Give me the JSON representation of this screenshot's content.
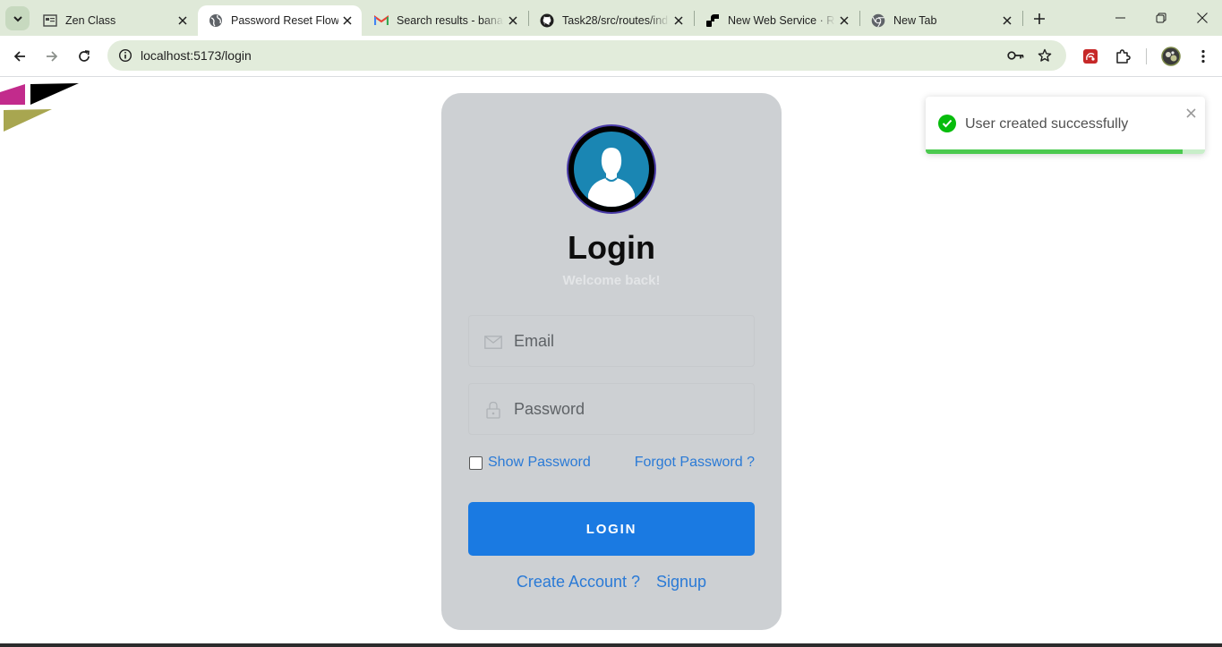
{
  "tabs": [
    {
      "title": "Zen Class",
      "icon": "zen-class-favicon",
      "active": false
    },
    {
      "title": "Password Reset Flow",
      "icon": "globe-icon",
      "active": true
    },
    {
      "title": "Search results - banal",
      "icon": "gmail-icon",
      "active": false
    },
    {
      "title": "Task28/src/routes/ind",
      "icon": "github-icon",
      "active": false
    },
    {
      "title": "New Web Service · R",
      "icon": "render-icon",
      "active": false
    },
    {
      "title": "New Tab",
      "icon": "chrome-icon",
      "active": false
    }
  ],
  "address_bar": {
    "url": "localhost:5173/login"
  },
  "login_card": {
    "title": "Login",
    "subtitle": "Welcome back!",
    "email_placeholder": "Email",
    "password_placeholder": "Password",
    "show_password_label": "Show Password",
    "show_password_checked": false,
    "forgot_password_label": "Forgot Password ?",
    "login_button_label": "LOGIN",
    "create_account_label": "Create Account ?",
    "signup_label": "Signup"
  },
  "toast": {
    "message": "User created successfully",
    "type": "success",
    "progress": 0.92
  },
  "colors": {
    "accent": "#1a7ae2",
    "link": "#2a7ad6",
    "card_bg": "#cdd0d3",
    "toast_success": "#07bc0c",
    "tabstrip_bg": "#dfe9d8"
  }
}
